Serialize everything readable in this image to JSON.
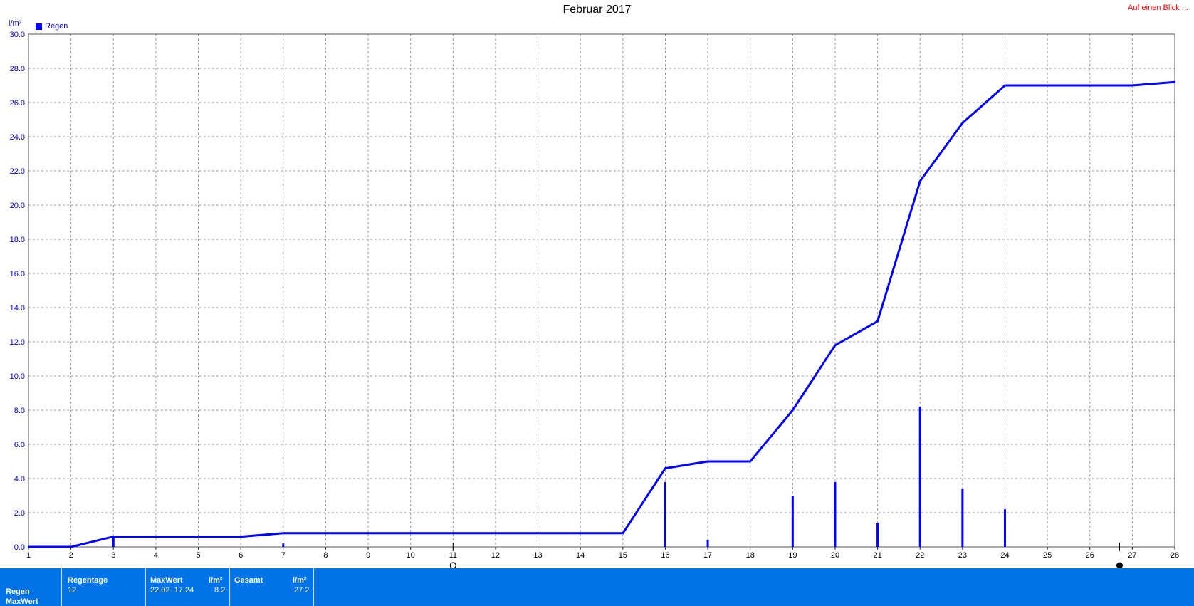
{
  "chart_data": {
    "type": "bar",
    "title": "Februar 2017",
    "ylabel": "l/m²",
    "ylim": [
      0,
      30
    ],
    "yticks": [
      "0.0",
      "2.0",
      "4.0",
      "6.0",
      "8.0",
      "10.0",
      "12.0",
      "14.0",
      "16.0",
      "18.0",
      "20.0",
      "22.0",
      "24.0",
      "26.0",
      "28.0",
      "30.0"
    ],
    "xlim": [
      1,
      28
    ],
    "xticks": [
      "1",
      "2",
      "3",
      "4",
      "5",
      "6",
      "7",
      "8",
      "9",
      "10",
      "11",
      "12",
      "13",
      "14",
      "15",
      "16",
      "17",
      "18",
      "19",
      "20",
      "21",
      "22",
      "23",
      "24",
      "25",
      "26",
      "27",
      "28"
    ],
    "grid": true,
    "legend": "top-left",
    "series": [
      {
        "name": "Regen",
        "type": "bar",
        "color": "#0000ff",
        "x": [
          3,
          7,
          16,
          17,
          19,
          20,
          21,
          22,
          23,
          24
        ],
        "values": [
          0.6,
          0.2,
          3.8,
          0.4,
          3.0,
          3.8,
          1.4,
          8.2,
          3.4,
          2.2
        ]
      },
      {
        "type": "line",
        "color": "#0000ff",
        "x": [
          1,
          2,
          3,
          6,
          7,
          15,
          16,
          17,
          18,
          19,
          20,
          21,
          22,
          23,
          24,
          27,
          28
        ],
        "values": [
          0,
          0,
          0.6,
          0.6,
          0.8,
          0.8,
          4.6,
          5.0,
          5.0,
          8.0,
          11.8,
          13.2,
          21.4,
          24.8,
          27.0,
          27.0,
          27.2
        ]
      }
    ],
    "markers": [
      {
        "x": 11,
        "symbol": "open-circle"
      },
      {
        "x": 26.7,
        "symbol": "filled-circle"
      }
    ]
  },
  "header": {
    "unit": "l/m²",
    "legend_label": "Regen",
    "link": "Auf einen Blick ..."
  },
  "panel": {
    "row_label_1": "Regen",
    "row_label_2": "MaxWert",
    "regentage_header": "Regentage",
    "regentage_value": "12",
    "maxwert_header": "MaxWert",
    "maxwert_unit": "l/m²",
    "maxwert_date": "22.02.  17:24",
    "maxwert_value": "8.2",
    "gesamt_header": "Gesamt",
    "gesamt_unit": "l/m²",
    "gesamt_value": "27.2"
  }
}
